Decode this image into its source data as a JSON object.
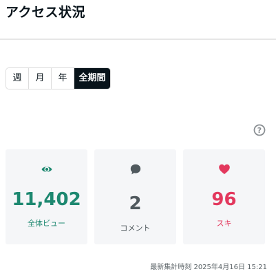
{
  "header": {
    "title": "アクセス状況"
  },
  "period_tabs": [
    {
      "label": "週",
      "active": false
    },
    {
      "label": "月",
      "active": false
    },
    {
      "label": "年",
      "active": false
    },
    {
      "label": "全期間",
      "active": true
    }
  ],
  "help": {
    "icon": "question-circle-icon",
    "symbol": "?"
  },
  "stats": [
    {
      "icon": "eye-icon",
      "value": "11,402",
      "label": "全体ビュー",
      "color": "#1d8870"
    },
    {
      "icon": "speech-bubble-icon",
      "value": "2",
      "label": "コメント",
      "color": "#50595e"
    },
    {
      "icon": "heart-icon",
      "value": "96",
      "label": "スキ",
      "color": "#e3385d"
    }
  ],
  "footer": {
    "timestamp": "最新集計時刻 2025年4月16日 15:21"
  }
}
